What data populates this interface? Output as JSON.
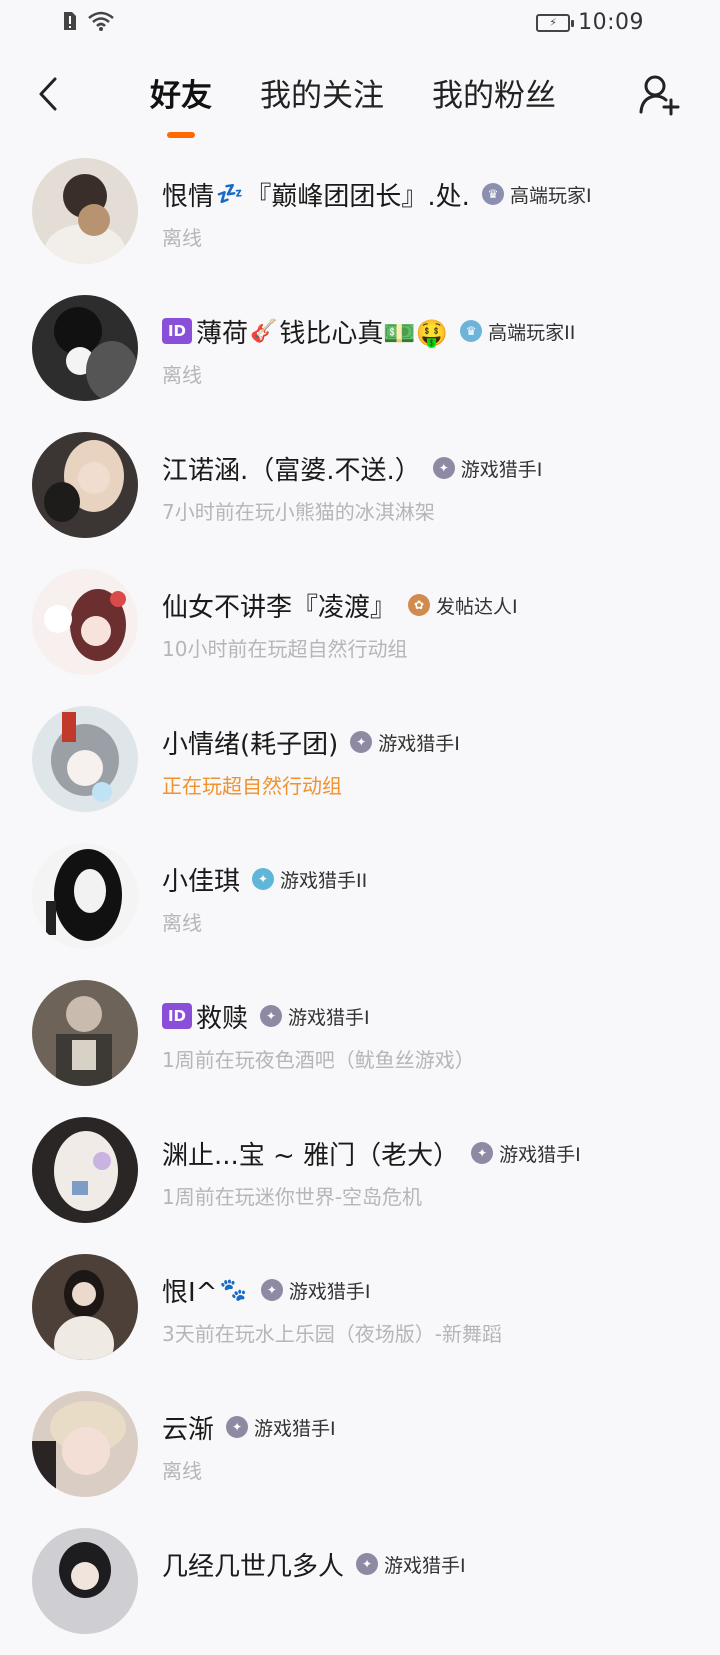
{
  "status_bar": {
    "time": "10:09"
  },
  "header": {
    "tabs": [
      {
        "label": "好友",
        "active": true
      },
      {
        "label": "我的关注",
        "active": false
      },
      {
        "label": "我的粉丝",
        "active": false
      }
    ],
    "accent_color": "#ff6a00"
  },
  "friends": [
    {
      "name": "恨情",
      "emoji": "💤",
      "name_suffix": "『巅峰团团长』.处.",
      "badge": "高端玩家I",
      "badge_icon": "trophy-icon",
      "status": "离线",
      "playing": false
    },
    {
      "id_chip": "ID",
      "name": "薄荷",
      "emoji": "🎸",
      "name_suffix": "钱比心真💵🤑",
      "badge": "高端玩家II",
      "badge_icon": "trophy-icon",
      "status": "离线",
      "playing": false
    },
    {
      "name": "江诺涵.（富婆.不送.）",
      "badge": "游戏猎手I",
      "badge_icon": "hunter-icon",
      "status": "7小时前在玩小熊猫的冰淇淋架",
      "playing": false
    },
    {
      "name": "仙女不讲李『凌渡』",
      "badge": "发帖达人I",
      "badge_icon": "post-icon",
      "status": "10小时前在玩超自然行动组",
      "playing": false
    },
    {
      "name": "小情绪(耗子团)",
      "badge": "游戏猎手I",
      "badge_icon": "hunter-icon",
      "status": "正在玩超自然行动组",
      "playing": true
    },
    {
      "name": "小佳琪",
      "badge": "游戏猎手II",
      "badge_icon": "hunter-icon",
      "status": "离线",
      "playing": false
    },
    {
      "id_chip": "ID",
      "name": "救赎",
      "badge": "游戏猎手I",
      "badge_icon": "hunter-icon",
      "status": "1周前在玩夜色酒吧（鱿鱼丝游戏）",
      "playing": false
    },
    {
      "name": "渊止...宝 ~ 雅门（老大）",
      "badge": "游戏猎手I",
      "badge_icon": "hunter-icon",
      "status": "1周前在玩迷你世界-空岛危机",
      "playing": false
    },
    {
      "name": "恨I^",
      "emoji": "🐾",
      "badge": "游戏猎手I",
      "badge_icon": "hunter-icon",
      "status": "3天前在玩水上乐园（夜场版）-新舞蹈",
      "playing": false
    },
    {
      "name": "云渐",
      "badge": "游戏猎手I",
      "badge_icon": "hunter-icon",
      "status": "离线",
      "playing": false
    },
    {
      "name": "几经几世几多人",
      "badge": "游戏猎手I",
      "badge_icon": "hunter-icon",
      "status": "",
      "playing": false
    }
  ]
}
